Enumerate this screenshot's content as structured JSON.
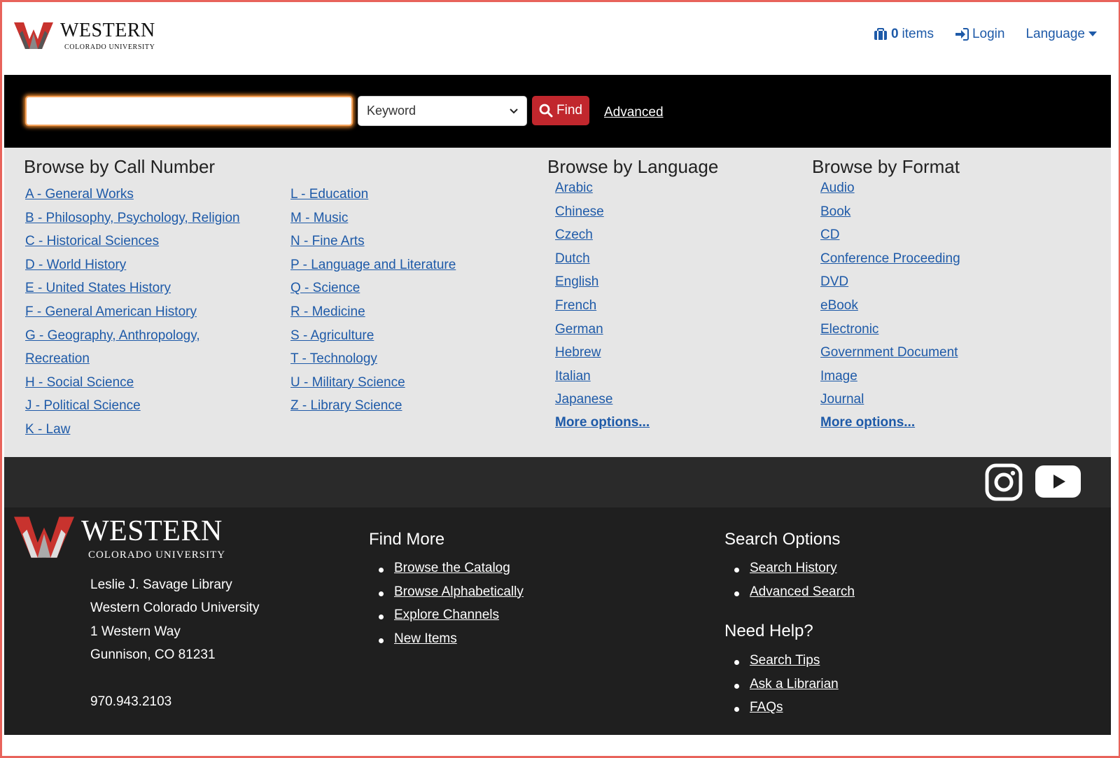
{
  "header": {
    "logo_name": "WESTERN",
    "logo_sub": "COLORADO UNIVERSITY",
    "cart_count": "0",
    "cart_label": "items",
    "login_label": "Login",
    "language_label": "Language"
  },
  "search": {
    "input_value": "",
    "select_value": "Keyword",
    "find_label": "Find",
    "advanced_label": "Advanced"
  },
  "browse": {
    "call_number_heading": "Browse by Call Number",
    "call_number_col1": [
      "A - General Works",
      "B - Philosophy, Psychology, Religion",
      "C - Historical Sciences",
      "D - World History",
      "E - United States History",
      "F - General American History",
      "G - Geography, Anthropology,",
      "Recreation",
      "H - Social Science",
      "J - Political Science",
      "K - Law"
    ],
    "call_number_col2": [
      "L - Education",
      "M - Music",
      "N - Fine Arts",
      "P - Language and Literature",
      "Q - Science",
      "R - Medicine",
      "S - Agriculture",
      "T - Technology",
      "U - Military Science",
      "Z - Library Science"
    ],
    "language_heading": "Browse by Language",
    "languages": [
      "Arabic",
      "Chinese",
      "Czech",
      "Dutch",
      "English",
      "French",
      "German",
      "Hebrew",
      "Italian",
      "Japanese"
    ],
    "language_more": "More options...",
    "format_heading": "Browse by Format",
    "formats": [
      "Audio",
      "Book",
      "CD",
      "Conference Proceeding",
      "DVD",
      "eBook",
      "Electronic",
      "Government Document",
      "Image",
      "Journal"
    ],
    "format_more": "More options..."
  },
  "social": {
    "icons": [
      "instagram-icon",
      "youtube-icon"
    ]
  },
  "footer": {
    "logo_name": "WESTERN",
    "logo_sub": "COLORADO UNIVERSITY",
    "address": [
      "Leslie J. Savage Library",
      "Western Colorado University",
      "1 Western Way",
      "Gunnison, CO 81231"
    ],
    "phone": "970.943.2103",
    "find_more_heading": "Find More",
    "find_more": [
      "Browse the Catalog",
      "Browse Alphabetically",
      "Explore Channels",
      "New Items"
    ],
    "search_options_heading": "Search Options",
    "search_options": [
      "Search History",
      "Advanced Search"
    ],
    "need_help_heading": "Need Help?",
    "need_help": [
      "Search Tips",
      "Ask a Librarian",
      "FAQs"
    ]
  },
  "colors": {
    "link": "#1e5aa8",
    "find_button": "#c1272d",
    "brand_red": "#c8332e"
  }
}
